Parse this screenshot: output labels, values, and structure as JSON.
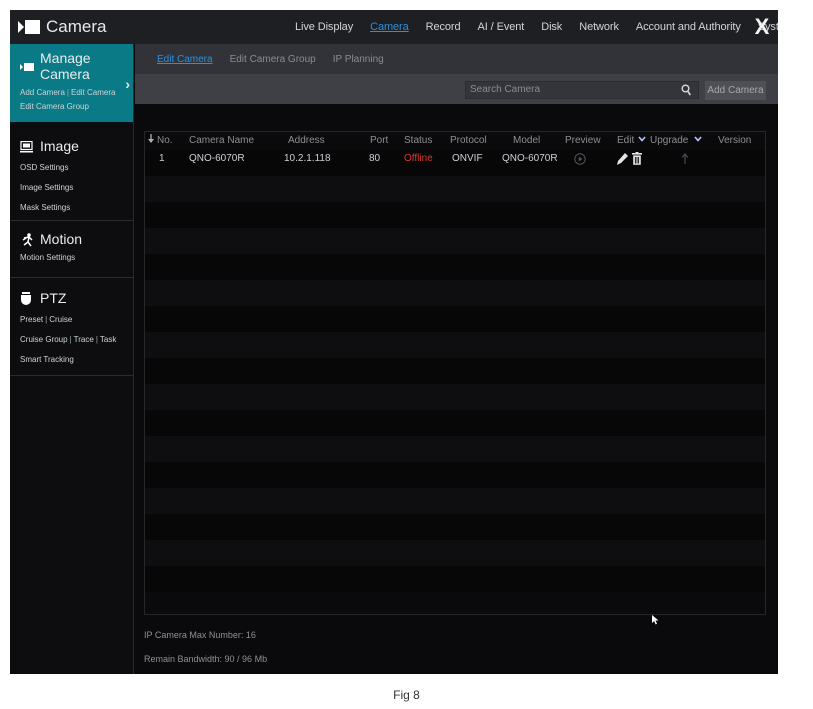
{
  "app": {
    "title": "Camera"
  },
  "nav": [
    {
      "label": "Live Display",
      "active": false
    },
    {
      "label": "Camera",
      "active": true
    },
    {
      "label": "Record",
      "active": false
    },
    {
      "label": "AI / Event",
      "active": false
    },
    {
      "label": "Disk",
      "active": false
    },
    {
      "label": "Network",
      "active": false
    },
    {
      "label": "Account and Authority",
      "active": false
    },
    {
      "label": "System",
      "active": false
    }
  ],
  "close_label": "X",
  "sidebar": {
    "manage": {
      "title": "Manage Camera",
      "links": [
        "Add Camera",
        "Edit Camera",
        "Edit Camera Group"
      ]
    },
    "image": {
      "title": "Image",
      "links": [
        "OSD Settings",
        "Image Settings",
        "Mask Settings"
      ]
    },
    "motion": {
      "title": "Motion",
      "links": [
        "Motion Settings"
      ]
    },
    "ptz": {
      "title": "PTZ",
      "links": [
        "Preset",
        "Cruise",
        "Cruise Group",
        "Trace",
        "Task",
        "Smart Tracking"
      ]
    }
  },
  "tabs": [
    {
      "label": "Edit Camera",
      "active": true
    },
    {
      "label": "Edit Camera Group",
      "active": false
    },
    {
      "label": "IP Planning",
      "active": false
    }
  ],
  "toolbar": {
    "search_placeholder": "Search Camera",
    "add_label": "Add Camera"
  },
  "table": {
    "headers": {
      "no": "No.",
      "name": "Camera Name",
      "address": "Address",
      "port": "Port",
      "status": "Status",
      "protocol": "Protocol",
      "model": "Model",
      "preview": "Preview",
      "edit": "Edit",
      "upgrade": "Upgrade",
      "version": "Version"
    },
    "rows": [
      {
        "no": "1",
        "name": "QNO-6070R",
        "address": "10.2.1.118",
        "port": "80",
        "status": "Offline",
        "protocol": "ONVIF",
        "model": "QNO-6070R",
        "version": ""
      }
    ]
  },
  "footer": {
    "max_number": "IP Camera Max Number: 16",
    "bandwidth": "Remain Bandwidth: 90 / 96 Mb"
  },
  "caption": "Fig 8",
  "colors": {
    "accent": "#0a7a86",
    "link": "#2a8fe0",
    "offline": "#d8382c"
  }
}
